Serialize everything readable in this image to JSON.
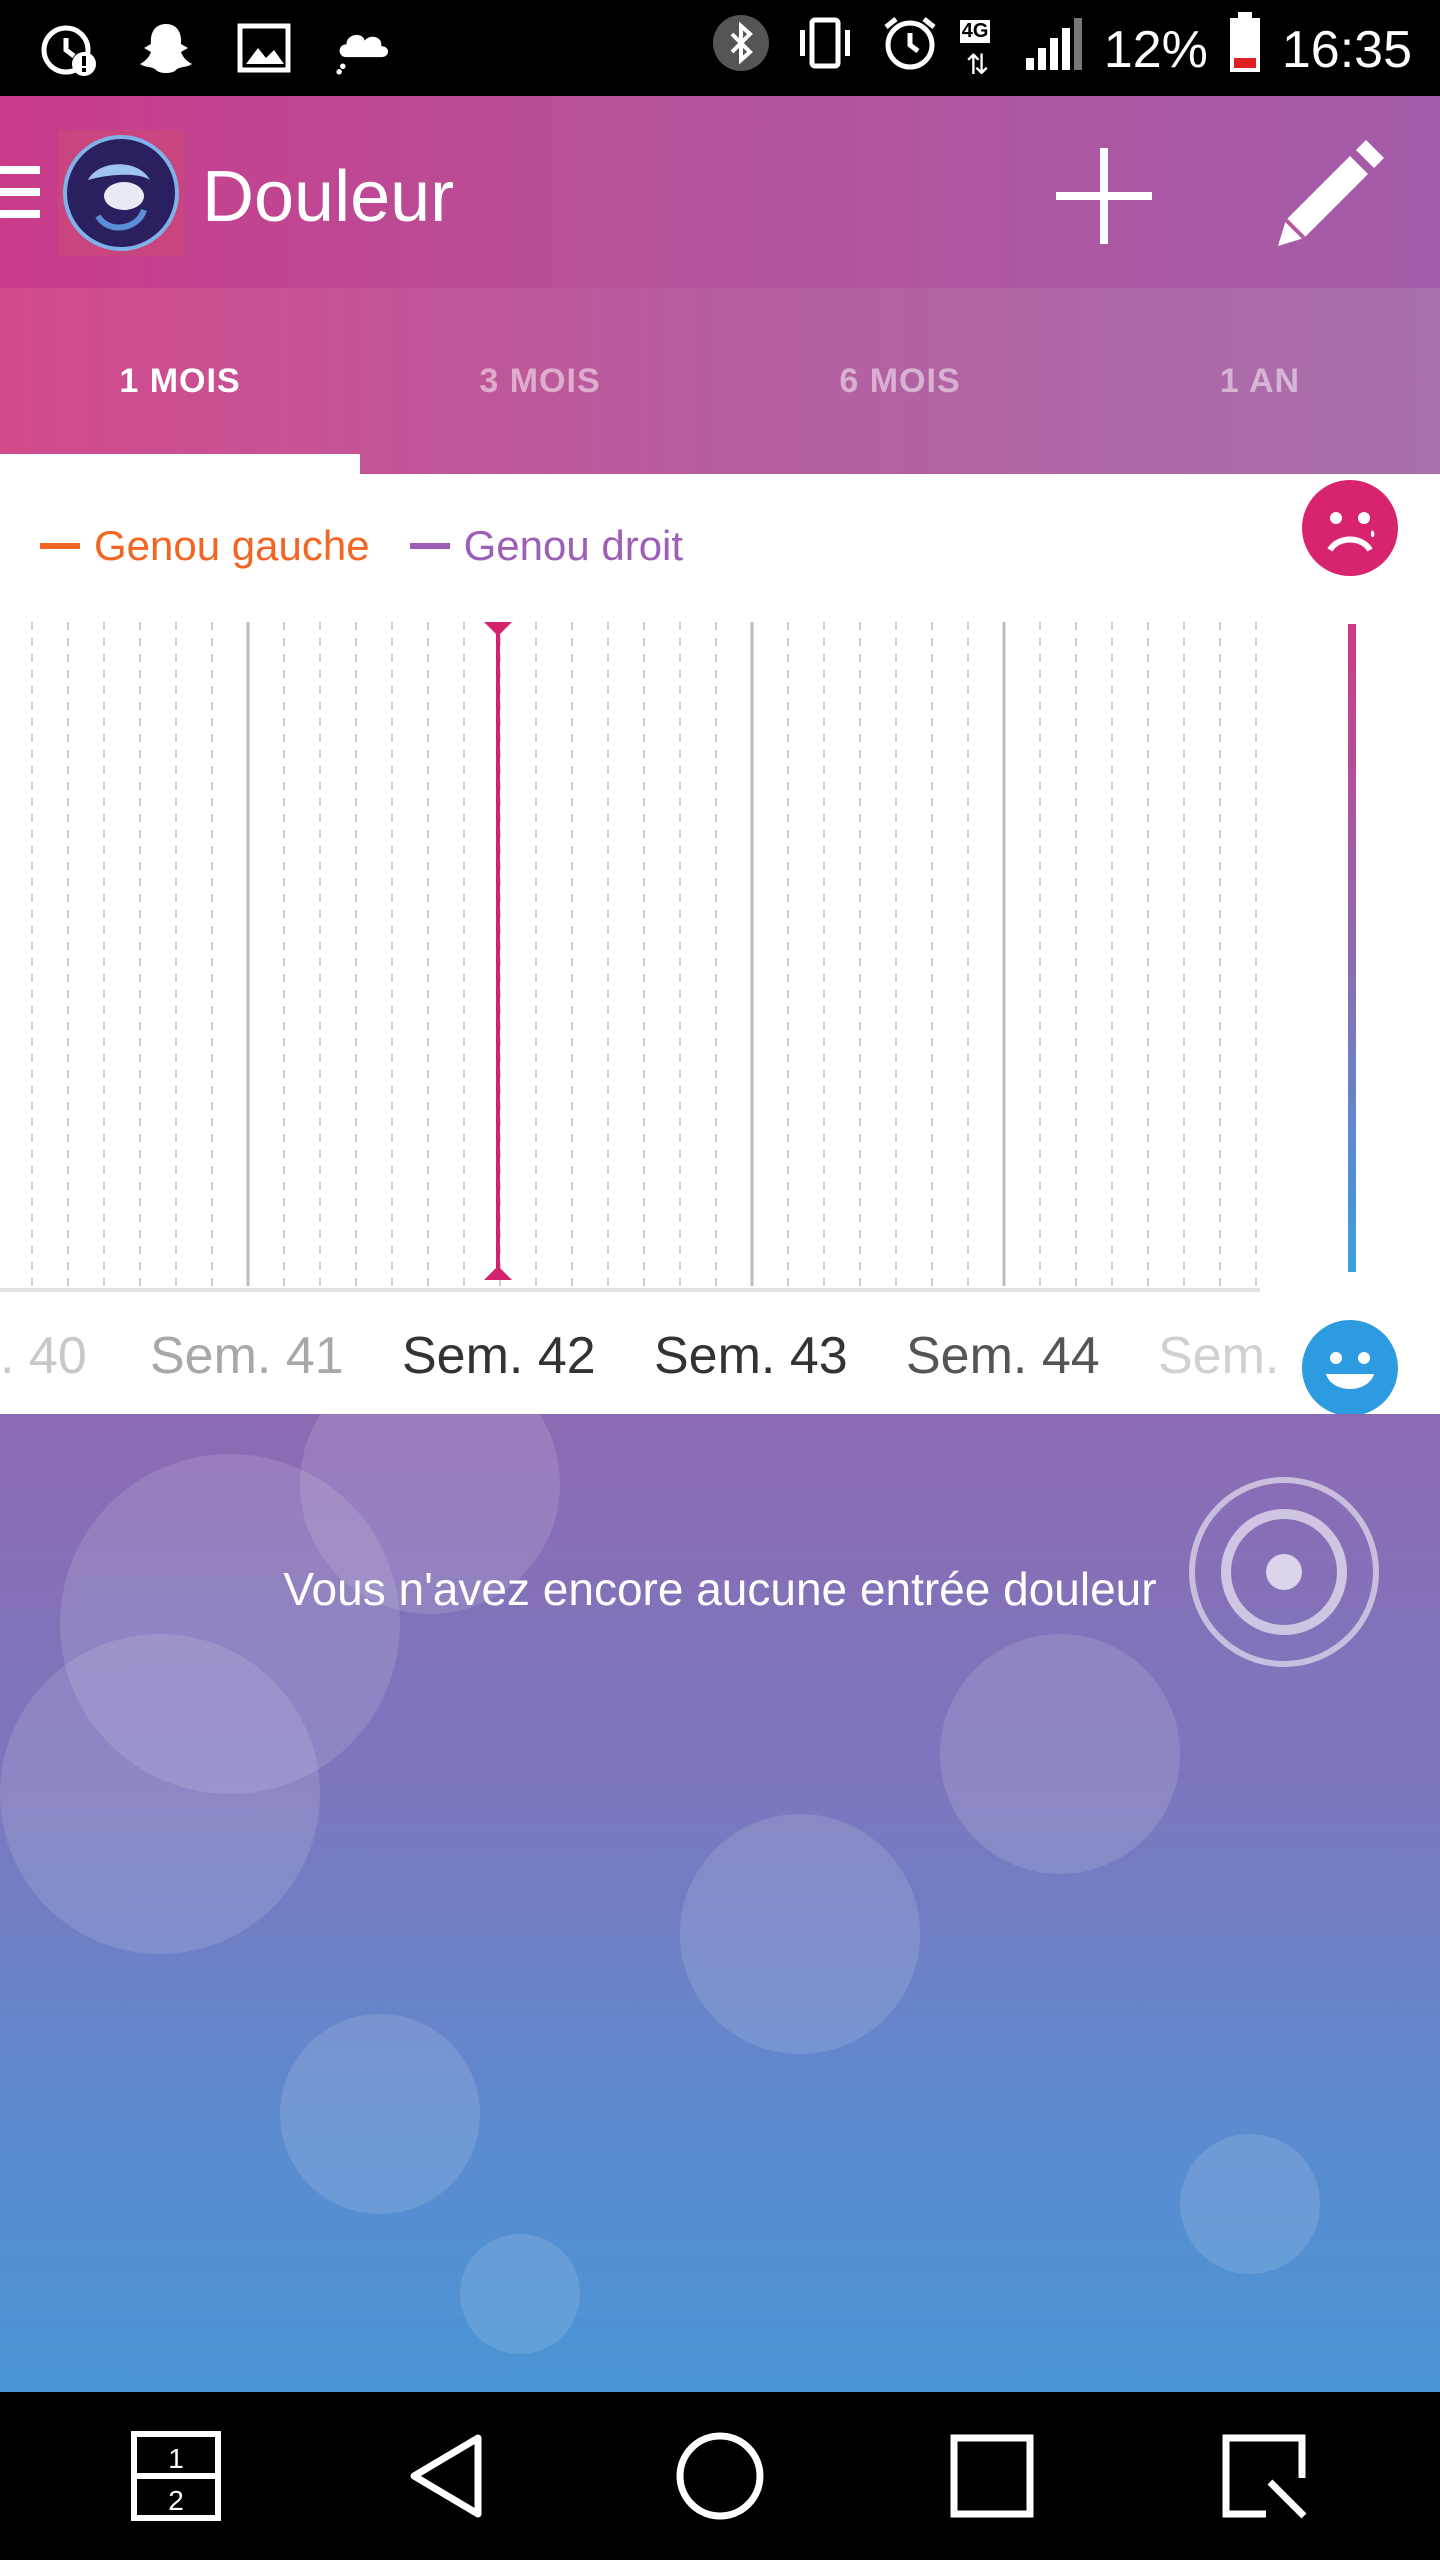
{
  "status_bar": {
    "left_icons": [
      "alarm-alert-icon",
      "snapchat-icon",
      "image-icon",
      "weather-icon"
    ],
    "right_icons": [
      "bluetooth-icon",
      "vibrate-icon",
      "alarm-icon",
      "network-4g-icon",
      "signal-icon",
      "battery-icon"
    ],
    "network": "4G",
    "battery": "12%",
    "time": "16:35"
  },
  "app_bar": {
    "title": "Douleur"
  },
  "tabs": [
    {
      "label": "1 MOIS",
      "active": true
    },
    {
      "label": "3 MOIS",
      "active": false
    },
    {
      "label": "6 MOIS",
      "active": false
    },
    {
      "label": "1 AN",
      "active": false
    }
  ],
  "legend": [
    {
      "label": "Genou gauche",
      "color": "#f26522"
    },
    {
      "label": "Genou droit",
      "color": "#9c5fb5"
    }
  ],
  "chart": {
    "week_labels": [
      ". 40",
      "Sem. 41",
      "Sem. 42",
      "Sem. 43",
      "Sem. 44",
      "Sem."
    ],
    "selected_week": "Sem. 42"
  },
  "scale": {
    "top_icon": "sad-face-icon",
    "bottom_icon": "happy-face-icon",
    "top_color": "#d8236f",
    "bottom_color": "#2c9be0"
  },
  "empty_state": {
    "message": "Vous n'avez encore aucune entrée douleur"
  },
  "nav_bar": {
    "dual_window_label_top": "1",
    "dual_window_label_bottom": "2"
  }
}
